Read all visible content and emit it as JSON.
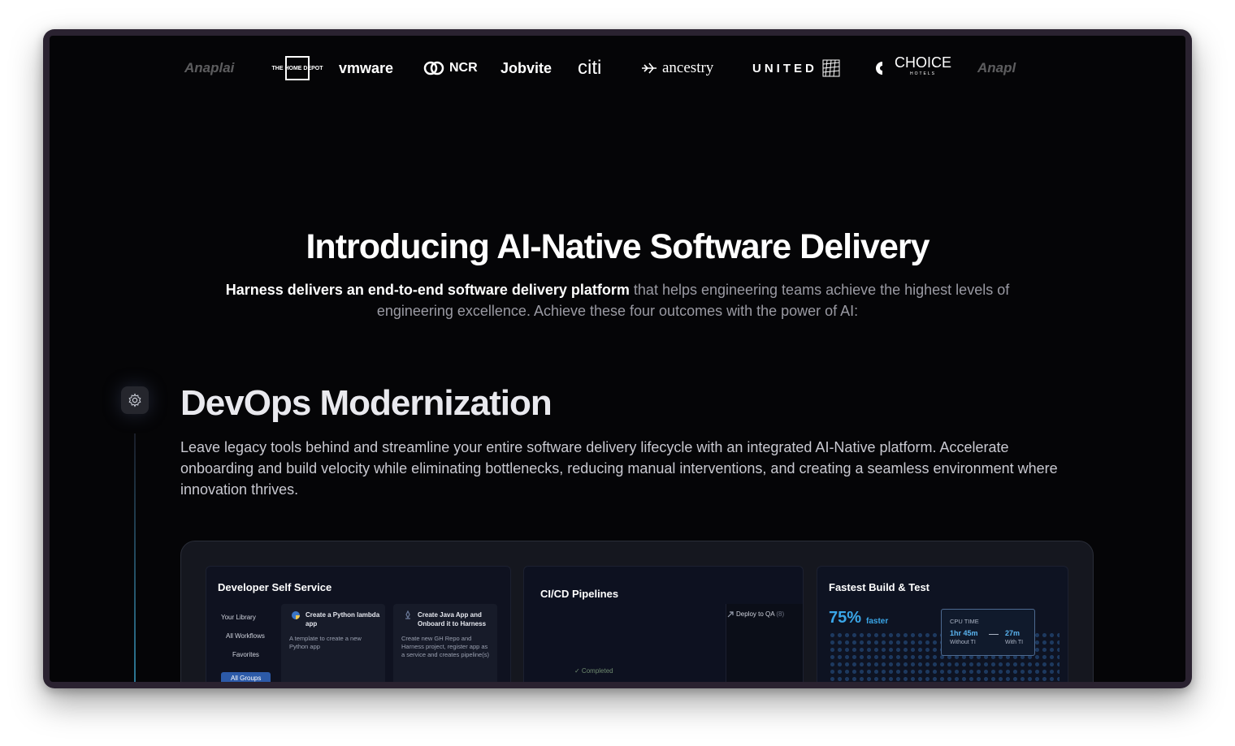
{
  "logos": [
    "Anaplan",
    "The Home Depot",
    "vmware",
    "NCR",
    "Jobvite",
    "citi",
    "ancestry",
    "UNITED",
    "CHOICE",
    "Anapl"
  ],
  "logo_display": {
    "anaplan": "Anaplai",
    "homedepot": "THE HOME DEPOT",
    "vmware": "vmware",
    "ncr": "NCR",
    "jobvite": "Jobvite",
    "citi": "citi",
    "ancestry": "ancestry",
    "united": "UNITED",
    "choice": "CHOICE",
    "choice_sub": "HOTELS",
    "anaplan2": "Anapl"
  },
  "hero": {
    "title": "Introducing AI-Native Software Delivery",
    "intro_bold": "Harness delivers an end-to-end software delivery platform",
    "intro_rest": " that helps engineering teams achieve the highest levels of engineering excellence. Achieve these four outcomes with the power of AI:"
  },
  "section": {
    "title": "DevOps Modernization",
    "description": "Leave legacy tools behind and streamline your entire software delivery lifecycle with an integrated AI-Native platform. Accelerate onboarding and build velocity while eliminating bottlenecks, reducing manual interventions, and creating a seamless environment where innovation thrives."
  },
  "dashboard": {
    "self_service": {
      "title": "Developer Self Service",
      "library": [
        "Your Library",
        "All Workflows",
        "Favorites",
        "All Groups"
      ],
      "templates": [
        {
          "title": "Create a Python lambda app",
          "desc": "A template to create a new Python app"
        },
        {
          "title": "Create Java App and Onboard it to Harness",
          "desc": "Create new GH Repo and Harness project, register app as a service and creates pipeline(s)"
        }
      ]
    },
    "pipelines": {
      "title": "CI/CD Pipelines",
      "deploy_label": "Deploy to QA",
      "deploy_count": "(8)",
      "status": "✓ Completed"
    },
    "build_test": {
      "title": "Fastest Build & Test",
      "percent": "75%",
      "percent_label": "faster",
      "cpu_title": "CPU TIME",
      "without_value": "1hr 45m",
      "without_label": "Without TI",
      "with_value": "27m",
      "with_label": "With TI"
    }
  },
  "colors": {
    "background": "#050507",
    "accent": "#3aa6e8",
    "active": "#2c5aa8"
  }
}
